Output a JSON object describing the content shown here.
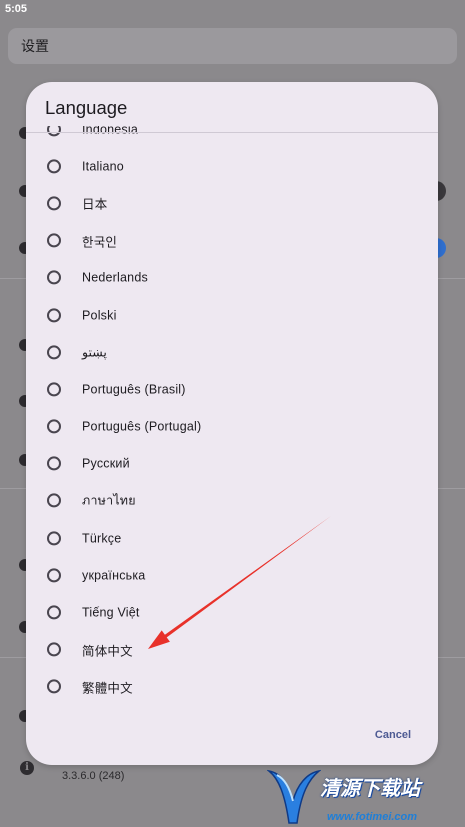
{
  "colors": {
    "scrim": "#8b898c",
    "header_bg": "#9b999d",
    "dialog_bg": "#eee8f1",
    "text": "#1d1b20",
    "radio": "#49454f",
    "accent": "#4d5a93",
    "arrow": "#e8312a",
    "toggle_on": "#2f6fcf"
  },
  "status_bar": {
    "time": "5:05"
  },
  "header": {
    "title": "设置"
  },
  "background": {
    "version": "3.3.6.0 (248)",
    "version_icon": "info-icon"
  },
  "dialog": {
    "title": "Language",
    "options": [
      {
        "label": "Indonesia",
        "checked": false
      },
      {
        "label": "Italiano",
        "checked": false
      },
      {
        "label": "日本",
        "checked": false
      },
      {
        "label": "한국인",
        "checked": false
      },
      {
        "label": "Nederlands",
        "checked": false
      },
      {
        "label": "Polski",
        "checked": false
      },
      {
        "label": "پښتو",
        "checked": false
      },
      {
        "label": "Português (Brasil)",
        "checked": false
      },
      {
        "label": "Português (Portugal)",
        "checked": false
      },
      {
        "label": "Русский",
        "checked": false
      },
      {
        "label": "ภาษาไทย",
        "checked": false
      },
      {
        "label": "Türkçe",
        "checked": false
      },
      {
        "label": "українська",
        "checked": false
      },
      {
        "label": "Tiếng Việt",
        "checked": false
      },
      {
        "label": "简体中文",
        "checked": false
      },
      {
        "label": "繁體中文",
        "checked": false
      }
    ],
    "cancel_label": "Cancel"
  },
  "watermark": {
    "name": "清源下载站",
    "url": "www.fotimei.com"
  }
}
